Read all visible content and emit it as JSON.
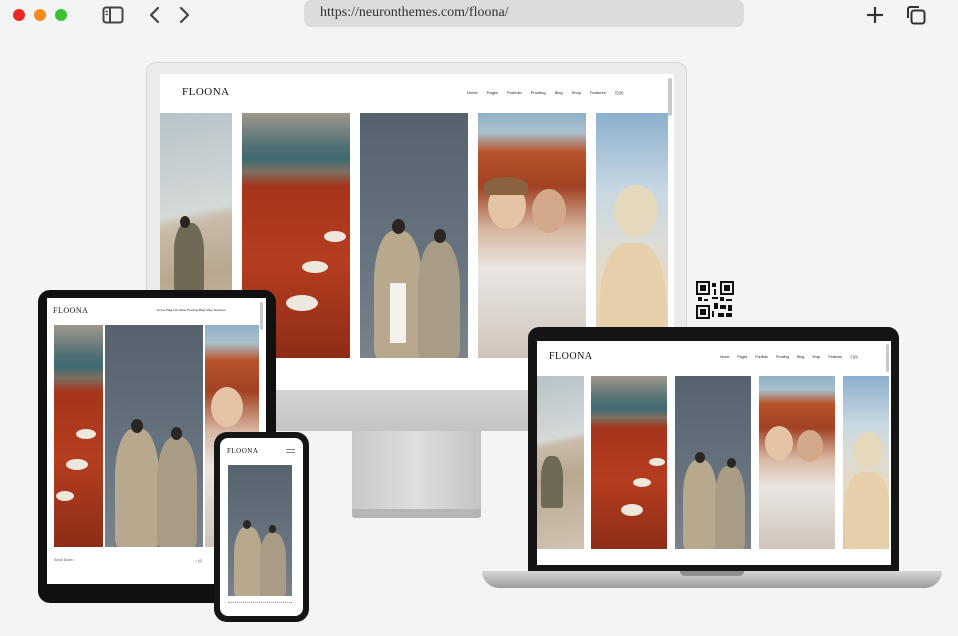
{
  "browser": {
    "url": "https://neuronthemes.com/floona/",
    "icons": [
      "sidebar-icon",
      "back-icon",
      "forward-icon",
      "new-tab-icon",
      "tabs-icon"
    ],
    "traffic_lights": [
      "#ee2626",
      "#f58a1f",
      "#3bc233"
    ]
  },
  "site": {
    "logo": "FLOONA",
    "nav": [
      "Home",
      "Pages",
      "Portfolio",
      "Proofing",
      "Blog",
      "Shop",
      "Features"
    ],
    "cart": "(0)",
    "tablet_nav": "Home  Pages  Portfolio  Proofing  Blog  Shop  Features",
    "tablet_footer": "Scroll Down  ↑",
    "tablet_footer_right": "⌂    (0)"
  },
  "colors": {
    "accent": "#a5351c",
    "background": "#f3f4f4"
  }
}
